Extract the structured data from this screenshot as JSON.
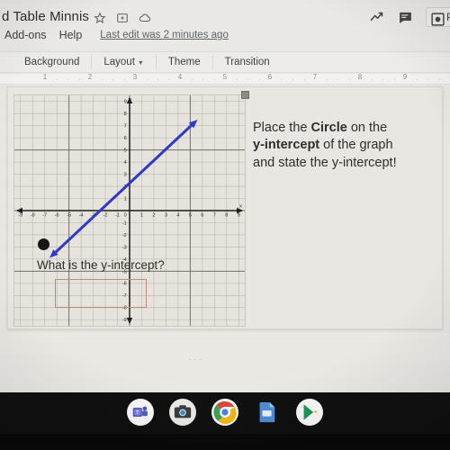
{
  "window": {
    "doc_title": "d Table Minnis",
    "title_icons": [
      "star-icon",
      "move-to-folder-icon",
      "cloud-status-icon"
    ],
    "menu_items": [
      "Add-ons",
      "Help"
    ],
    "last_edit": "Last edit was 2 minutes ago",
    "right_icons": [
      "activity-chart-icon",
      "comment-icon"
    ],
    "present_label": "Pr",
    "present_icon": "present-icon"
  },
  "toolbar": {
    "items": [
      {
        "label": "Background",
        "has_caret": false
      },
      {
        "label": "Layout",
        "has_caret": true
      },
      {
        "label": "Theme",
        "has_caret": false
      },
      {
        "label": "Transition",
        "has_caret": false
      }
    ]
  },
  "ruler": {
    "numbers": [
      "1",
      "2",
      "3",
      "4",
      "5",
      "6",
      "7",
      "8",
      "9"
    ]
  },
  "slide": {
    "prompt_line1_a": "Place the ",
    "prompt_line1_b": "Circle",
    "prompt_line1_c": " on the",
    "prompt_line2_a": "y-intercept",
    "prompt_line2_b": " of the graph",
    "prompt_line3": "and state the y-intercept!",
    "question": "What is the y-intercept?",
    "answer_value": "",
    "answer_placeholder": "",
    "circle_name": "draggable-circle-shape",
    "answer_box_border_color": "#c48a78"
  },
  "chart_data": {
    "type": "line",
    "title": "",
    "xlabel": "x",
    "ylabel": "y",
    "xlim": [
      -9.5,
      9.5
    ],
    "ylim": [
      -9.5,
      9.5
    ],
    "grid": true,
    "x_ticks": [
      -9,
      -8,
      -7,
      -6,
      -5,
      -4,
      -3,
      -2,
      -1,
      0,
      1,
      2,
      3,
      4,
      5,
      6,
      7,
      8,
      9
    ],
    "y_ticks": [
      -9,
      -8,
      -7,
      -6,
      -5,
      -4,
      -3,
      -2,
      -1,
      1,
      2,
      3,
      4,
      5,
      6,
      7,
      8,
      9
    ],
    "origin_label": "0",
    "series": [
      {
        "name": "line",
        "color": "#2b37d4",
        "slope": 0.9,
        "y_intercept": 2,
        "arrow_both_ends": true,
        "x_start": -6.6,
        "y_start": -3.9,
        "x_end": 5.6,
        "y_end": 7.5,
        "points": [
          [
            -6.6,
            -3.9
          ],
          [
            0,
            2
          ],
          [
            5.6,
            7.5
          ]
        ]
      }
    ],
    "legend_position": "none"
  },
  "below_slide": {
    "dots": "..."
  },
  "shelf": {
    "icons": [
      {
        "name": "teams-icon",
        "active": false
      },
      {
        "name": "camera-icon",
        "active": false
      },
      {
        "name": "chrome-icon",
        "active": true
      },
      {
        "name": "google-slides-icon",
        "active": false
      },
      {
        "name": "play-store-icon",
        "active": false
      }
    ]
  }
}
